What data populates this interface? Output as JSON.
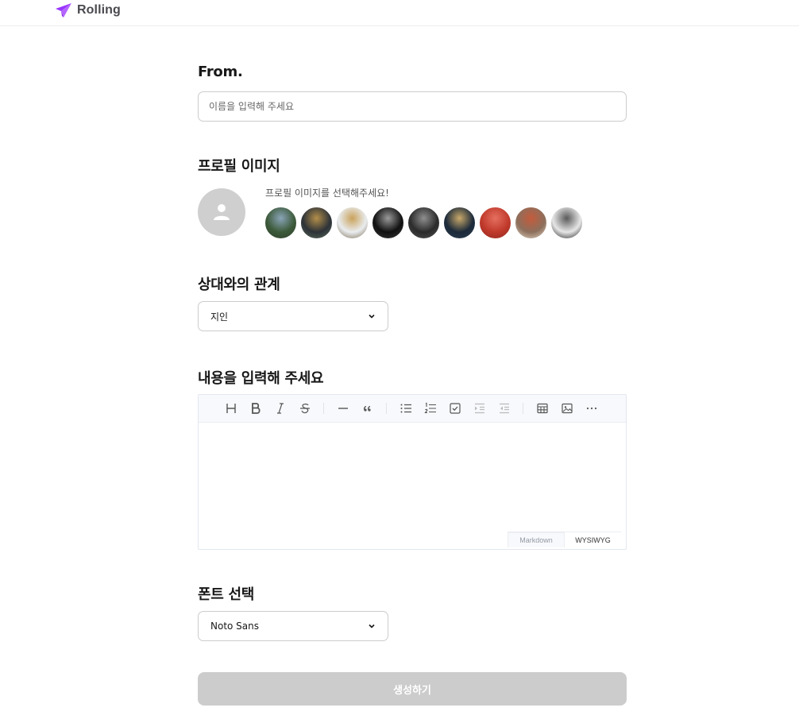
{
  "header": {
    "brand": "Rolling",
    "accent": "#9935ff"
  },
  "from": {
    "title": "From.",
    "placeholder": "이름을 입력해 주세요",
    "value": ""
  },
  "profile": {
    "title": "프로필 이미지",
    "hint": "프로필 이미지를 선택해주세요!",
    "options": [
      {
        "name": "profile-option-1",
        "colors": [
          "#3c5a3a",
          "#8aa4b8",
          "#2f3f2c"
        ]
      },
      {
        "name": "profile-option-2",
        "colors": [
          "#2d3238",
          "#b38f4a",
          "#5d6b5a"
        ]
      },
      {
        "name": "profile-option-3",
        "colors": [
          "#e9ecef",
          "#c9a25b",
          "#7a6a4e"
        ]
      },
      {
        "name": "profile-option-4",
        "colors": [
          "#111111",
          "#9a9a9a",
          "#3a3a3a"
        ]
      },
      {
        "name": "profile-option-5",
        "colors": [
          "#2b2b2b",
          "#8f8f8f",
          "#525252"
        ]
      },
      {
        "name": "profile-option-6",
        "colors": [
          "#1c2a3a",
          "#c9a96a",
          "#2d3e50"
        ]
      },
      {
        "name": "profile-option-7",
        "colors": [
          "#c0392b",
          "#e57060",
          "#8e2a20"
        ]
      },
      {
        "name": "profile-option-8",
        "colors": [
          "#8c6f5c",
          "#c45b3c",
          "#e8d9c8"
        ]
      },
      {
        "name": "profile-option-9",
        "colors": [
          "#e6e6e6",
          "#5a5a5a",
          "#1f1f1f"
        ]
      }
    ]
  },
  "relationship": {
    "title": "상대와의 관계",
    "selected": "지인"
  },
  "content": {
    "title": "내용을 입력해 주세요",
    "toolbar": [
      "heading",
      "bold",
      "italic",
      "strike",
      "hr",
      "quote",
      "bullet-list",
      "ordered-list",
      "task-list",
      "indent",
      "outdent",
      "table",
      "image",
      "more"
    ],
    "mode_markdown": "Markdown",
    "mode_wysiwyg": "WYSIWYG"
  },
  "font": {
    "title": "폰트 선택",
    "selected": "Noto Sans"
  },
  "submit": {
    "label": "생성하기",
    "disabled_color": "#cccccc"
  }
}
